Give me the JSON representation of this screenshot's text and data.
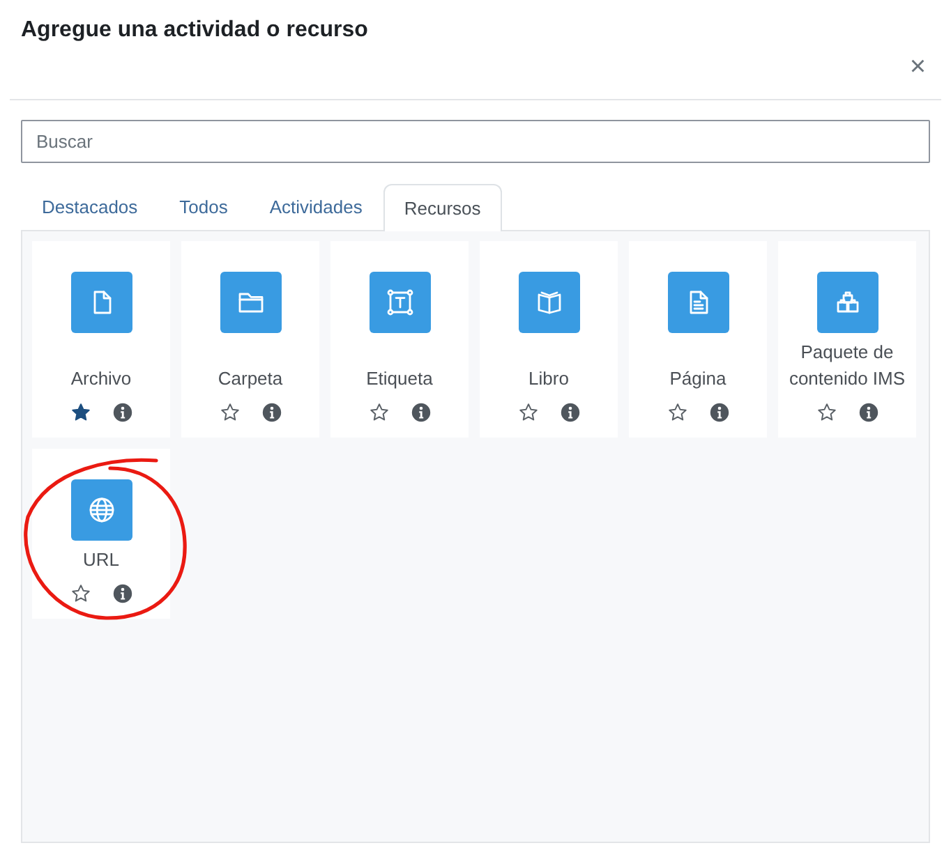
{
  "dialog": {
    "title": "Agregue una actividad o recurso",
    "close": "×"
  },
  "search": {
    "placeholder": "Buscar"
  },
  "tabs": [
    {
      "label": "Destacados",
      "selected": false
    },
    {
      "label": "Todos",
      "selected": false
    },
    {
      "label": "Actividades",
      "selected": false
    },
    {
      "label": "Recursos",
      "selected": true
    }
  ],
  "items": [
    {
      "name": "Archivo",
      "kind": "file",
      "starred": true,
      "circled": false
    },
    {
      "name": "Carpeta",
      "kind": "folder",
      "starred": false,
      "circled": false
    },
    {
      "name": "Etiqueta",
      "kind": "label",
      "starred": false,
      "circled": false
    },
    {
      "name": "Libro",
      "kind": "book",
      "starred": false,
      "circled": false
    },
    {
      "name": "Página",
      "kind": "page",
      "starred": false,
      "circled": false
    },
    {
      "name": "Paquete de contenido IMS",
      "kind": "package",
      "starred": false,
      "circled": false
    },
    {
      "name": "URL",
      "kind": "url",
      "starred": false,
      "circled": true
    }
  ]
}
